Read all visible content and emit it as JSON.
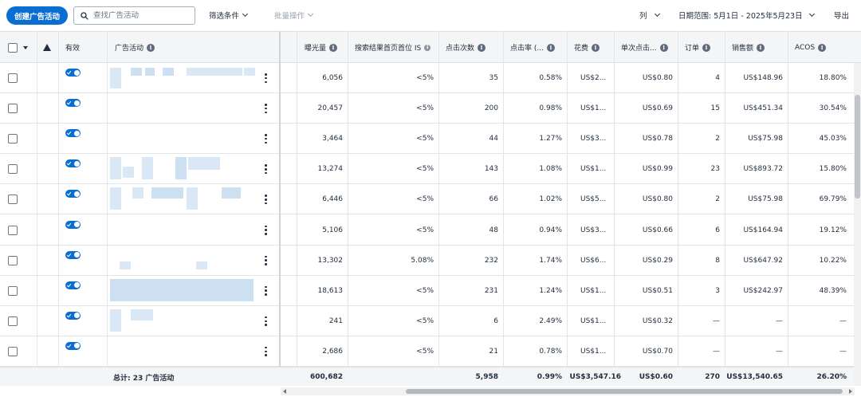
{
  "toolbar": {
    "create_label": "创建广告活动",
    "search_placeholder": "查找广告活动",
    "filter_label": "筛选条件",
    "bulk_label": "批量操作",
    "columns_label": "列",
    "date_range_label": "日期范围: 5月1日 - 2025年5月23日",
    "export_label": "导出"
  },
  "headers": {
    "active": "有效",
    "campaign": "广告活动",
    "impressions": "曝光量",
    "top_is": "搜索结果首页首位 IS",
    "clicks": "点击次数",
    "ctr": "点击率 (...",
    "spend": "花费",
    "cpc": "单次点击...",
    "orders": "订单",
    "sales": "销售额",
    "acos": "ACOS"
  },
  "rows": [
    {
      "impressions": "6,056",
      "top_is": "<5%",
      "clicks": "35",
      "ctr": "0.58%",
      "spend": "US$2...",
      "cpc": "US$0.80",
      "orders": "4",
      "sales": "US$148.96",
      "acos": "18.80%"
    },
    {
      "impressions": "20,457",
      "top_is": "<5%",
      "clicks": "200",
      "ctr": "0.98%",
      "spend": "US$1...",
      "cpc": "US$0.69",
      "orders": "15",
      "sales": "US$451.34",
      "acos": "30.54%"
    },
    {
      "impressions": "3,464",
      "top_is": "<5%",
      "clicks": "44",
      "ctr": "1.27%",
      "spend": "US$3...",
      "cpc": "US$0.78",
      "orders": "2",
      "sales": "US$75.98",
      "acos": "45.03%"
    },
    {
      "impressions": "13,274",
      "top_is": "<5%",
      "clicks": "143",
      "ctr": "1.08%",
      "spend": "US$1...",
      "cpc": "US$0.99",
      "orders": "23",
      "sales": "US$893.72",
      "acos": "15.80%"
    },
    {
      "impressions": "6,446",
      "top_is": "<5%",
      "clicks": "66",
      "ctr": "1.02%",
      "spend": "US$5...",
      "cpc": "US$0.80",
      "orders": "2",
      "sales": "US$75.98",
      "acos": "69.79%"
    },
    {
      "impressions": "5,106",
      "top_is": "<5%",
      "clicks": "48",
      "ctr": "0.94%",
      "spend": "US$3...",
      "cpc": "US$0.66",
      "orders": "6",
      "sales": "US$164.94",
      "acos": "19.12%"
    },
    {
      "impressions": "13,302",
      "top_is": "5.08%",
      "clicks": "232",
      "ctr": "1.74%",
      "spend": "US$6...",
      "cpc": "US$0.29",
      "orders": "8",
      "sales": "US$647.92",
      "acos": "10.22%"
    },
    {
      "impressions": "18,613",
      "top_is": "<5%",
      "clicks": "231",
      "ctr": "1.24%",
      "spend": "US$1...",
      "cpc": "US$0.51",
      "orders": "3",
      "sales": "US$242.97",
      "acos": "48.39%"
    },
    {
      "impressions": "241",
      "top_is": "<5%",
      "clicks": "6",
      "ctr": "2.49%",
      "spend": "US$1...",
      "cpc": "US$0.32",
      "orders": "—",
      "sales": "—",
      "acos": "—"
    },
    {
      "impressions": "2,686",
      "top_is": "<5%",
      "clicks": "21",
      "ctr": "0.78%",
      "spend": "US$1...",
      "cpc": "US$0.70",
      "orders": "—",
      "sales": "—",
      "acos": "—"
    }
  ],
  "footer": {
    "total_label": "总计:  23 广告活动",
    "impressions": "600,682",
    "clicks": "5,958",
    "ctr": "0.99%",
    "spend": "US$3,547.16",
    "cpc": "US$0.60",
    "orders": "270",
    "sales": "US$13,540.65",
    "acos": "26.20%"
  },
  "colors": {
    "accent": "#0a6ed1",
    "blur": "#bcd5ee"
  }
}
